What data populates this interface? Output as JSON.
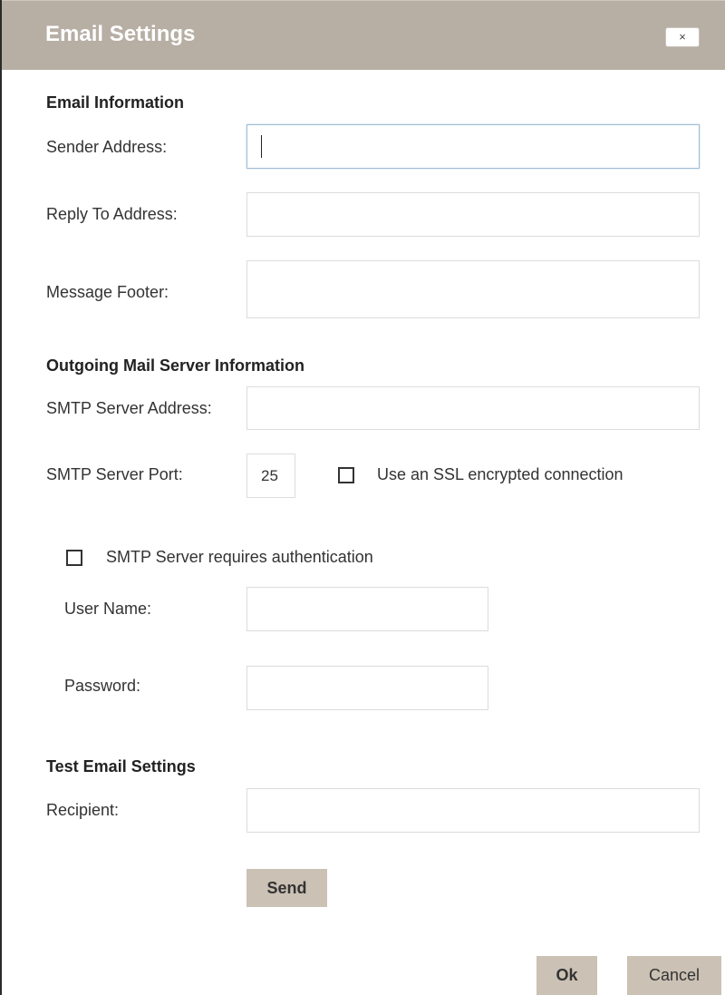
{
  "dialog": {
    "title": "Email Settings",
    "close_label": "×"
  },
  "email_info": {
    "heading": "Email Information",
    "sender_label": "Sender Address:",
    "sender_value": "",
    "reply_label": "Reply To Address:",
    "reply_value": "",
    "footer_label": "Message Footer:",
    "footer_value": ""
  },
  "outgoing": {
    "heading": "Outgoing Mail Server Information",
    "smtp_address_label": "SMTP Server Address:",
    "smtp_address_value": "",
    "smtp_port_label": "SMTP Server Port:",
    "smtp_port_value": "25",
    "ssl_label": "Use an SSL encrypted connection",
    "ssl_checked": false,
    "auth_label": "SMTP Server requires authentication",
    "auth_checked": false,
    "username_label": "User Name:",
    "username_value": "",
    "password_label": "Password:",
    "password_value": ""
  },
  "test": {
    "heading": "Test Email Settings",
    "recipient_label": "Recipient:",
    "recipient_value": "",
    "send_label": "Send"
  },
  "footer": {
    "ok_label": "Ok",
    "cancel_label": "Cancel"
  },
  "colors": {
    "titlebar": "#b7aea4",
    "button": "#cbc1b4",
    "focus_border": "#9fbcd4"
  }
}
